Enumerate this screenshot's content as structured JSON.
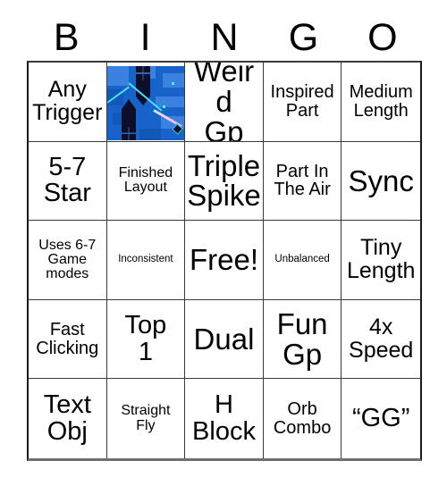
{
  "card": {
    "title": "BINGO",
    "header_letters": [
      "B",
      "I",
      "N",
      "G",
      "O"
    ],
    "free_space_label": "Free!",
    "colors": {
      "background": "#ffffff",
      "text": "#000000",
      "grid_line": "#3a3a3a",
      "image_blue": "#1763c9",
      "image_trail_cyan": "#45e3f5"
    },
    "rows": [
      [
        {
          "text": "Any\nTrigger",
          "size": "s-l",
          "type": "text"
        },
        {
          "text": "",
          "size": "",
          "type": "image",
          "image_name": "geometry-dash-level-thumbnail"
        },
        {
          "text": "Weird\nGp",
          "size": "s-xxl",
          "type": "text"
        },
        {
          "text": "Inspired\nPart",
          "size": "s-m",
          "type": "text"
        },
        {
          "text": "Medium\nLength",
          "size": "s-m",
          "type": "text"
        }
      ],
      [
        {
          "text": "5-7\nStar",
          "size": "s-xl",
          "type": "text"
        },
        {
          "text": "Finished\nLayout",
          "size": "s-s",
          "type": "text"
        },
        {
          "text": "Triple\nSpike",
          "size": "s-xxl",
          "type": "text"
        },
        {
          "text": "Part In\nThe Air",
          "size": "s-m",
          "type": "text"
        },
        {
          "text": "Sync",
          "size": "s-xxl",
          "type": "text"
        }
      ],
      [
        {
          "text": "Uses 6-7\nGame\nmodes",
          "size": "s-s",
          "type": "text"
        },
        {
          "text": "Inconsistent",
          "size": "s-xs",
          "type": "text"
        },
        {
          "text": "Free!",
          "size": "s-xxl",
          "type": "text"
        },
        {
          "text": "Unbalanced",
          "size": "s-xs",
          "type": "text"
        },
        {
          "text": "Tiny\nLength",
          "size": "s-l",
          "type": "text"
        }
      ],
      [
        {
          "text": "Fast\nClicking",
          "size": "s-m",
          "type": "text"
        },
        {
          "text": "Top\n1",
          "size": "s-xl",
          "type": "text"
        },
        {
          "text": "Dual",
          "size": "s-xxl",
          "type": "text"
        },
        {
          "text": "Fun\nGp",
          "size": "s-xxl",
          "type": "text"
        },
        {
          "text": "4x\nSpeed",
          "size": "s-l",
          "type": "text"
        }
      ],
      [
        {
          "text": "Text\nObj",
          "size": "s-xl",
          "type": "text"
        },
        {
          "text": "Straight\nFly",
          "size": "s-s",
          "type": "text"
        },
        {
          "text": "H\nBlock",
          "size": "s-xl",
          "type": "text"
        },
        {
          "text": "Orb\nCombo",
          "size": "s-m",
          "type": "text"
        },
        {
          "text": "“GG”",
          "size": "s-xl",
          "type": "text"
        }
      ]
    ]
  }
}
